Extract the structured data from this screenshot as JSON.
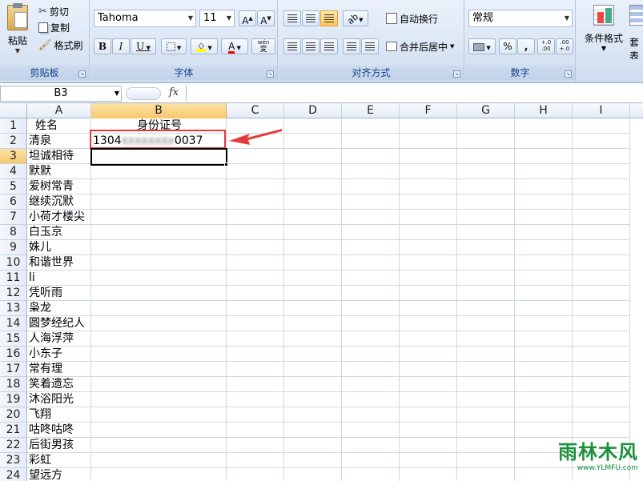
{
  "ribbon": {
    "clipboard": {
      "paste": "粘贴",
      "cut": "剪切",
      "copy": "复制",
      "format_painter": "格式刷",
      "label": "剪贴板"
    },
    "font": {
      "name": "Tahoma",
      "size": "11",
      "bold": "B",
      "italic": "I",
      "underline": "U",
      "wen": "wén",
      "label": "字体"
    },
    "alignment": {
      "wrap": "自动换行",
      "merge": "合并后居中",
      "label": "对齐方式"
    },
    "number": {
      "format": "常规",
      "percent": "%",
      "comma": ",",
      "inc_dec": "+.0\n.00",
      "dec_dec": ".00\n+.0",
      "label": "数字"
    },
    "styles": {
      "conditional": "条件格式",
      "table_partial": "表格",
      "partial": "套"
    }
  },
  "formula_bar": {
    "name_box": "B3",
    "fx": "fx",
    "value": ""
  },
  "columns": [
    "A",
    "B",
    "C",
    "D",
    "E",
    "F",
    "G",
    "H",
    "I"
  ],
  "rows": [
    {
      "n": "1",
      "a": "姓名",
      "b": "身份证号"
    },
    {
      "n": "2",
      "a": "清泉",
      "b_prefix": "1304",
      "b_hidden": "xxxxxxxx",
      "b_suffix": "0037"
    },
    {
      "n": "3",
      "a": "坦诚相待"
    },
    {
      "n": "4",
      "a": "默默"
    },
    {
      "n": "5",
      "a": "爱树常青"
    },
    {
      "n": "6",
      "a": "继续沉默"
    },
    {
      "n": "7",
      "a": "小荷才楼尖"
    },
    {
      "n": "8",
      "a": "白玉京"
    },
    {
      "n": "9",
      "a": "姝儿"
    },
    {
      "n": "10",
      "a": "和谐世界"
    },
    {
      "n": "11",
      "a": "li"
    },
    {
      "n": "12",
      "a": "凭听雨"
    },
    {
      "n": "13",
      "a": "枭龙"
    },
    {
      "n": "14",
      "a": "圆梦经纪人"
    },
    {
      "n": "15",
      "a": "人海浮萍"
    },
    {
      "n": "16",
      "a": "小东子"
    },
    {
      "n": "17",
      "a": "常有理"
    },
    {
      "n": "18",
      "a": "笑着遗忘"
    },
    {
      "n": "19",
      "a": "沐浴阳光"
    },
    {
      "n": "20",
      "a": "飞翔"
    },
    {
      "n": "21",
      "a": "咕咚咕咚"
    },
    {
      "n": "22",
      "a": "后街男孩"
    },
    {
      "n": "23",
      "a": "彩虹"
    },
    {
      "n": "24",
      "a": "望远方"
    }
  ],
  "watermark": {
    "title": "雨林木风",
    "url": "www.YLMFU.com"
  },
  "colors": {
    "annotation_red": "#e83a3a",
    "selected_header": "#f8c86e"
  }
}
